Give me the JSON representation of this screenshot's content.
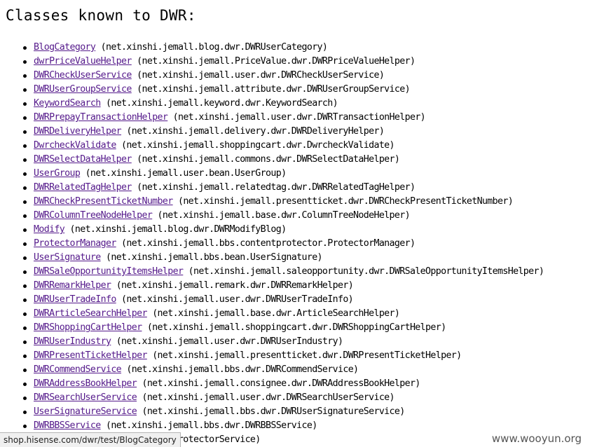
{
  "page": {
    "title": "Classes known to DWR:",
    "classes": [
      {
        "name": "BlogCategory",
        "path": "(net.xinshi.jemall.blog.dwr.DWRUserCategory)"
      },
      {
        "name": "dwrPriceValueHelper",
        "path": "(net.xinshi.jemall.PriceValue.dwr.DWRPriceValueHelper)"
      },
      {
        "name": "DWRCheckUserService",
        "path": "(net.xinshi.jemall.user.dwr.DWRCheckUserService)"
      },
      {
        "name": "DWRUserGroupService",
        "path": "(net.xinshi.jemall.attribute.dwr.DWRUserGroupService)"
      },
      {
        "name": "KeywordSearch",
        "path": "(net.xinshi.jemall.keyword.dwr.KeywordSearch)"
      },
      {
        "name": "DWRPrepayTransactionHelper",
        "path": "(net.xinshi.jemall.user.dwr.DWRTransactionHelper)"
      },
      {
        "name": "DWRDeliveryHelper",
        "path": "(net.xinshi.jemall.delivery.dwr.DWRDeliveryHelper)"
      },
      {
        "name": "DwrcheckValidate",
        "path": "(net.xinshi.jemall.shoppingcart.dwr.DwrcheckValidate)"
      },
      {
        "name": "DWRSelectDataHelper",
        "path": "(net.xinshi.jemall.commons.dwr.DWRSelectDataHelper)"
      },
      {
        "name": "UserGroup",
        "path": "(net.xinshi.jemall.user.bean.UserGroup)"
      },
      {
        "name": "DWRRelatedTagHelper",
        "path": "(net.xinshi.jemall.relatedtag.dwr.DWRRelatedTagHelper)"
      },
      {
        "name": "DWRCheckPresentTicketNumber",
        "path": "(net.xinshi.jemall.presentticket.dwr.DWRCheckPresentTicketNumber)"
      },
      {
        "name": "DWRColumnTreeNodeHelper",
        "path": "(net.xinshi.jemall.base.dwr.ColumnTreeNodeHelper)"
      },
      {
        "name": "Modify",
        "path": "(net.xinshi.jemall.blog.dwr.DWRModifyBlog)"
      },
      {
        "name": "ProtectorManager",
        "path": "(net.xinshi.jemall.bbs.contentprotector.ProtectorManager)"
      },
      {
        "name": "UserSignature",
        "path": "(net.xinshi.jemall.bbs.bean.UserSignature)"
      },
      {
        "name": "DWRSaleOpportunityItemsHelper",
        "path": "(net.xinshi.jemall.saleopportunity.dwr.DWRSaleOpportunityItemsHelper)"
      },
      {
        "name": "DWRRemarkHelper",
        "path": "(net.xinshi.jemall.remark.dwr.DWRRemarkHelper)"
      },
      {
        "name": "DWRUserTradeInfo",
        "path": "(net.xinshi.jemall.user.dwr.DWRUserTradeInfo)"
      },
      {
        "name": "DWRArticleSearchHelper",
        "path": "(net.xinshi.jemall.base.dwr.ArticleSearchHelper)"
      },
      {
        "name": "DWRShoppingCartHelper",
        "path": "(net.xinshi.jemall.shoppingcart.dwr.DWRShoppingCartHelper)"
      },
      {
        "name": "DWRUserIndustry",
        "path": "(net.xinshi.jemall.user.dwr.DWRUserIndustry)"
      },
      {
        "name": "DWRPresentTicketHelper",
        "path": "(net.xinshi.jemall.presentticket.dwr.DWRPresentTicketHelper)"
      },
      {
        "name": "DWRCommendService",
        "path": "(net.xinshi.jemall.bbs.dwr.DWRCommendService)"
      },
      {
        "name": "DWRAddressBookHelper",
        "path": "(net.xinshi.jemall.consignee.dwr.DWRAddressBookHelper)"
      },
      {
        "name": "DWRSearchUserService",
        "path": "(net.xinshi.jemall.user.dwr.DWRSearchUserService)"
      },
      {
        "name": "UserSignatureService",
        "path": "(net.xinshi.jemall.bbs.dwr.DWRUserSignatureService)"
      },
      {
        "name": "DWRBBSService",
        "path": "(net.xinshi.jemall.bbs.dwr.DWRBBSService)"
      },
      {
        "name": "",
        "path": "t.xinshi.jemall.bbs.dwr.DWRProtectorService)"
      }
    ]
  },
  "status_bar": {
    "url": "shop.hisense.com/dwr/test/BlogCategory"
  },
  "watermark": {
    "text": "www.wooyun.org"
  },
  "colors": {
    "link": "#551a8b",
    "text": "#000000",
    "background": "#ffffff"
  }
}
